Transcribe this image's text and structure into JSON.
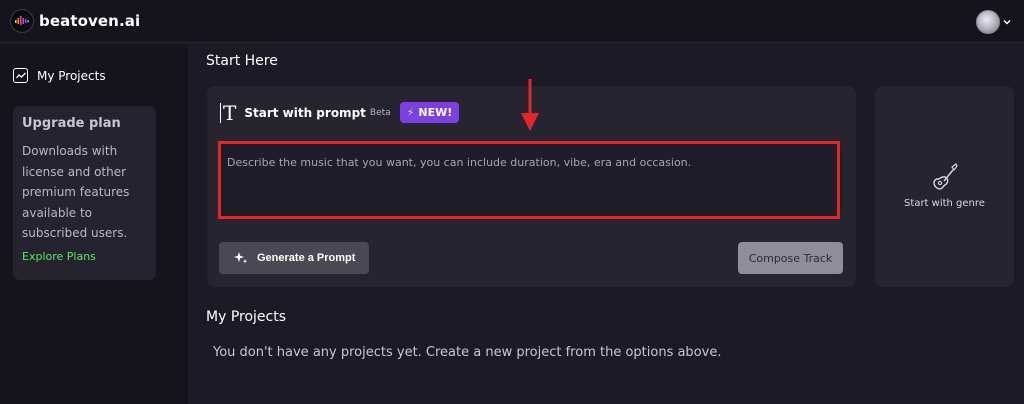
{
  "app": {
    "name": "beatoven.ai"
  },
  "sidebar": {
    "items": [
      {
        "label": "My Projects",
        "icon": "chart-icon"
      }
    ],
    "upgrade": {
      "title": "Upgrade plan",
      "body": "Downloads with license and other premium features available to subscribed users.",
      "link": "Explore Plans"
    }
  },
  "main": {
    "start_title": "Start Here",
    "prompt_card": {
      "title": "Start with prompt",
      "beta": "Beta",
      "badge": "NEW!",
      "placeholder": "Describe the music that you want, you can include duration, vibe, era and occasion.",
      "generate_label": "Generate a Prompt",
      "compose_label": "Compose Track"
    },
    "genre_card": {
      "label": "Start with genre",
      "icon": "guitar-icon"
    },
    "projects_title": "My Projects",
    "empty_message": "You don't have any projects yet. Create a new project from the options above."
  },
  "colors": {
    "background": "#1c1b25",
    "sidebar": "#15141c",
    "card": "#25242f",
    "accent_purple": "#7b3fe4",
    "link_green": "#5ee56a",
    "annotation_red": "#e4262b"
  }
}
